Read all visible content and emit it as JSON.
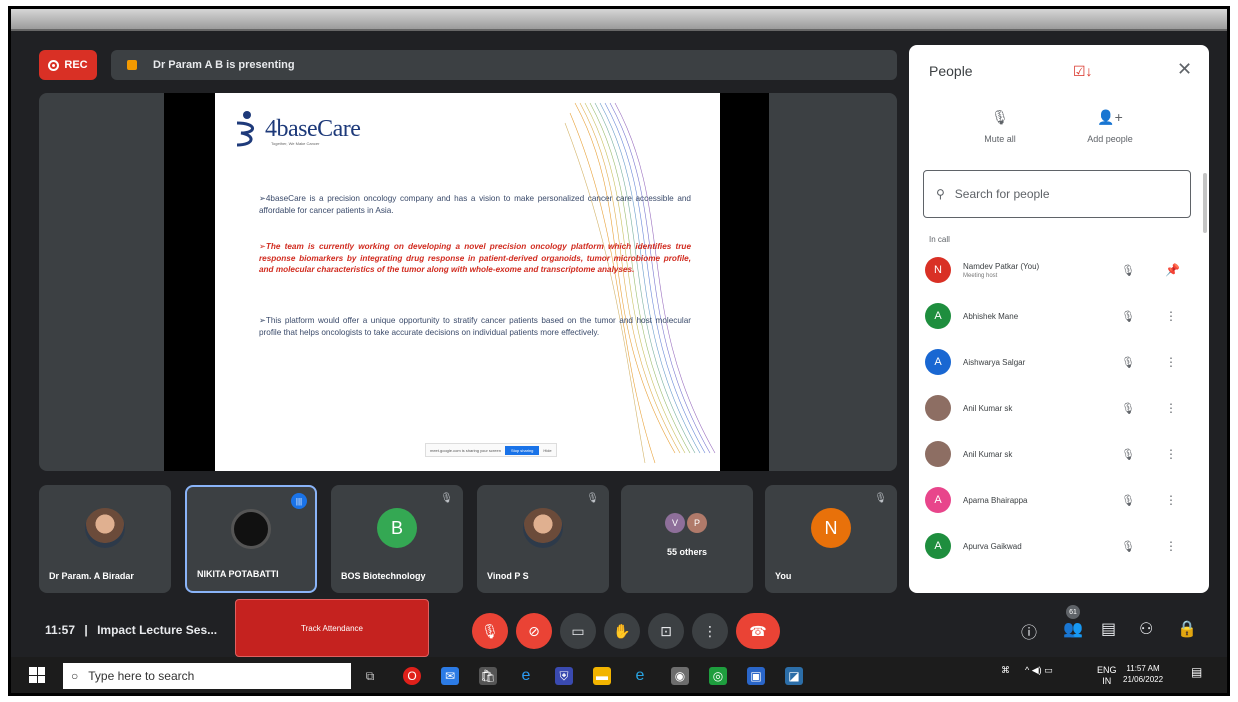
{
  "header": {
    "rec_label": "REC",
    "presenting_text": "Dr Param A B is presenting"
  },
  "slide": {
    "logo_text": "4baseCare",
    "logo_tagline": "Together, We Make Cancer",
    "paragraph1": "➢4baseCare is a precision oncology company and has a vision to make personalized cancer care accessible and affordable for cancer patients in Asia.",
    "paragraph2": "➢The team is currently working on developing a novel precision oncology platform which identifies true response biomarkers by integrating drug response in patient-derived organoids, tumor microbiome profile, and molecular characteristics of the tumor along with whole-exome and transcriptome analyses.",
    "paragraph3": "➢This platform would offer a unique opportunity to stratify cancer patients based on the tumor and host molecular profile that helps oncologists to take accurate decisions on individual patients more effectively.",
    "share_text": "meet.google.com is sharing your screen",
    "stop_sharing": "Stop sharing",
    "hide": "Hide"
  },
  "tiles": [
    {
      "name": "Dr Param. A Biradar"
    },
    {
      "name": "NIKITA POTABATTI"
    },
    {
      "name": "BOS Biotechnology",
      "initial": "B"
    },
    {
      "name": "Vinod P S"
    },
    {
      "name": "55 others",
      "initials": [
        "V",
        "P"
      ]
    },
    {
      "name": "You",
      "initial": "N"
    }
  ],
  "bottom": {
    "time": "11:57",
    "separator": "|",
    "meeting": "Impact Lecture Ses...",
    "attendance": "Track Attendance",
    "people_count": "61"
  },
  "panel": {
    "title": "People",
    "mute_all": "Mute all",
    "add_people": "Add people",
    "search_placeholder": "Search for people",
    "section": "In call",
    "people": [
      {
        "name": "Namdev Patkar (You)",
        "sub": "Meeting host",
        "initial": "N",
        "color": "#d93025"
      },
      {
        "name": "Abhishek Mane",
        "initial": "A",
        "color": "#1e8e3e"
      },
      {
        "name": "Aishwarya Salgar",
        "initial": "A",
        "color": "#1967d2"
      },
      {
        "name": "Anil Kumar sk",
        "initial": "",
        "color": "#8d6e63"
      },
      {
        "name": "Anil Kumar sk",
        "initial": "",
        "color": "#8d6e63"
      },
      {
        "name": "Aparna Bhairappa",
        "initial": "A",
        "color": "#e8458b"
      },
      {
        "name": "Apurva Gaikwad",
        "initial": "A",
        "color": "#1e8e3e"
      }
    ]
  },
  "taskbar": {
    "search_placeholder": "Type here to search",
    "lang1": "ENG",
    "lang2": "IN",
    "time": "11:57 AM",
    "date": "21/06/2022"
  }
}
